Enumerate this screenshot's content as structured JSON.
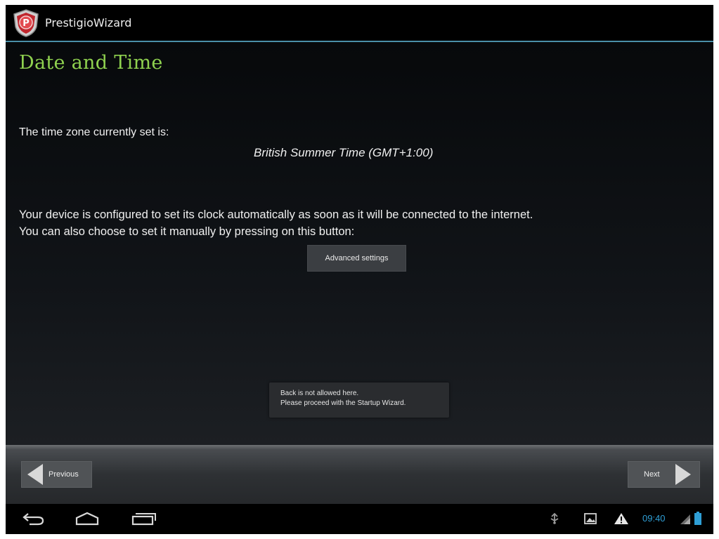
{
  "action_bar": {
    "app_name": "PrestigioWizard"
  },
  "content": {
    "title": "Date and Time",
    "timezone_label": "The time zone currently set is:",
    "timezone_value": "British Summer Time (GMT+1:00)",
    "description_line1": "Your device is configured to set its clock automatically as soon as it will be connected to the internet.",
    "description_line2": "You can also choose to set it manually by pressing on this button:",
    "advanced_button": "Advanced settings"
  },
  "toast": {
    "line1": "Back is not allowed here.",
    "line2": "Please proceed with the Startup Wizard."
  },
  "button_bar": {
    "previous_label": "Previous",
    "next_label": "Next"
  },
  "system_bar": {
    "clock": "09:40",
    "icons": [
      "back-icon",
      "home-icon",
      "recent-apps-icon",
      "usb-icon",
      "gallery-icon",
      "warning-icon",
      "signal-icon",
      "battery-icon"
    ]
  },
  "colors": {
    "title_green": "#8fd14f",
    "accent_blue": "#4a8fa8",
    "clock_blue": "#2f9fd6"
  }
}
